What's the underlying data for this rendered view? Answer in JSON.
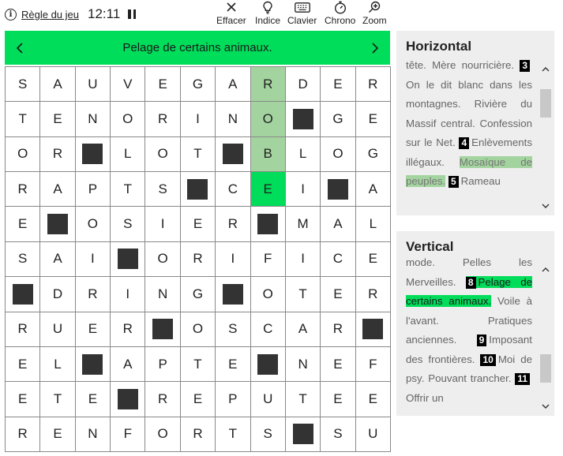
{
  "toolbar": {
    "rules_label": "Règle du jeu",
    "time": "12:11",
    "erase_label": "Effacer",
    "hint_label": "Indice",
    "keyboard_label": "Clavier",
    "timer_label": "Chrono",
    "zoom_label": "Zoom"
  },
  "clue_bar": {
    "text": "Pelage de certains animaux."
  },
  "colors": {
    "accent": "#00dd5a",
    "highlight": "#a3d49f",
    "block": "#333333"
  },
  "grid": {
    "rows": [
      [
        "S",
        "A",
        "U",
        "V",
        "E",
        "G",
        "A",
        "R",
        "D",
        "E",
        "R"
      ],
      [
        "T",
        "E",
        "N",
        "O",
        "R",
        "I",
        "N",
        "O",
        "#",
        "G",
        "E"
      ],
      [
        "O",
        "R",
        "#",
        "L",
        "O",
        "T",
        "#",
        "B",
        "L",
        "O",
        "G"
      ],
      [
        "R",
        "A",
        "P",
        "T",
        "S",
        "#",
        "C",
        "E",
        "I",
        "#",
        "A"
      ],
      [
        "E",
        "#",
        "O",
        "S",
        "I",
        "E",
        "R",
        "#",
        "M",
        "A",
        "L"
      ],
      [
        "S",
        "A",
        "I",
        "#",
        "O",
        "R",
        "I",
        "F",
        "I",
        "C",
        "E"
      ],
      [
        "#",
        "D",
        "R",
        "I",
        "N",
        "G",
        "#",
        "O",
        "T",
        "E",
        "R"
      ],
      [
        "R",
        "U",
        "E",
        "R",
        "#",
        "O",
        "S",
        "C",
        "A",
        "R",
        "#"
      ],
      [
        "E",
        "L",
        "#",
        "A",
        "P",
        "T",
        "E",
        "#",
        "N",
        "E",
        "F"
      ],
      [
        "E",
        "T",
        "E",
        "#",
        "R",
        "E",
        "P",
        "U",
        "T",
        "E",
        "E"
      ],
      [
        "R",
        "E",
        "N",
        "F",
        "O",
        "R",
        "T",
        "S",
        "#",
        "S",
        "U"
      ]
    ],
    "highlighted": [
      [
        0,
        7
      ],
      [
        1,
        7
      ],
      [
        2,
        7
      ]
    ],
    "active": [
      3,
      7
    ]
  },
  "horizontal": {
    "title": "Horizontal",
    "items": [
      {
        "text": "tête. Mère nourricière."
      },
      {
        "num": "3",
        "text": "On le dit blanc dans les montagnes."
      },
      {
        "text": "Rivière du Massif central."
      },
      {
        "text": "Confession sur le Net."
      },
      {
        "num": "4",
        "text": "Enlèvements illégaux."
      },
      {
        "text": "Mosaïque de peuples.",
        "state": "sel-soft"
      },
      {
        "num": "5",
        "text": "Rameau"
      }
    ]
  },
  "vertical": {
    "title": "Vertical",
    "items": [
      {
        "text": "mode. Pelles les"
      },
      {
        "text": "Merveilles."
      },
      {
        "num": "8",
        "text": "Pelage de certains animaux.",
        "state": "sel"
      },
      {
        "text": "Voile à l'avant."
      },
      {
        "text": "Pratiques anciennes."
      },
      {
        "num": "9",
        "text": "Imposant des frontières."
      },
      {
        "num": "10",
        "text": "Moi de psy."
      },
      {
        "text": "Pouvant trancher."
      },
      {
        "num": "11",
        "text": "Offrir un"
      }
    ]
  }
}
